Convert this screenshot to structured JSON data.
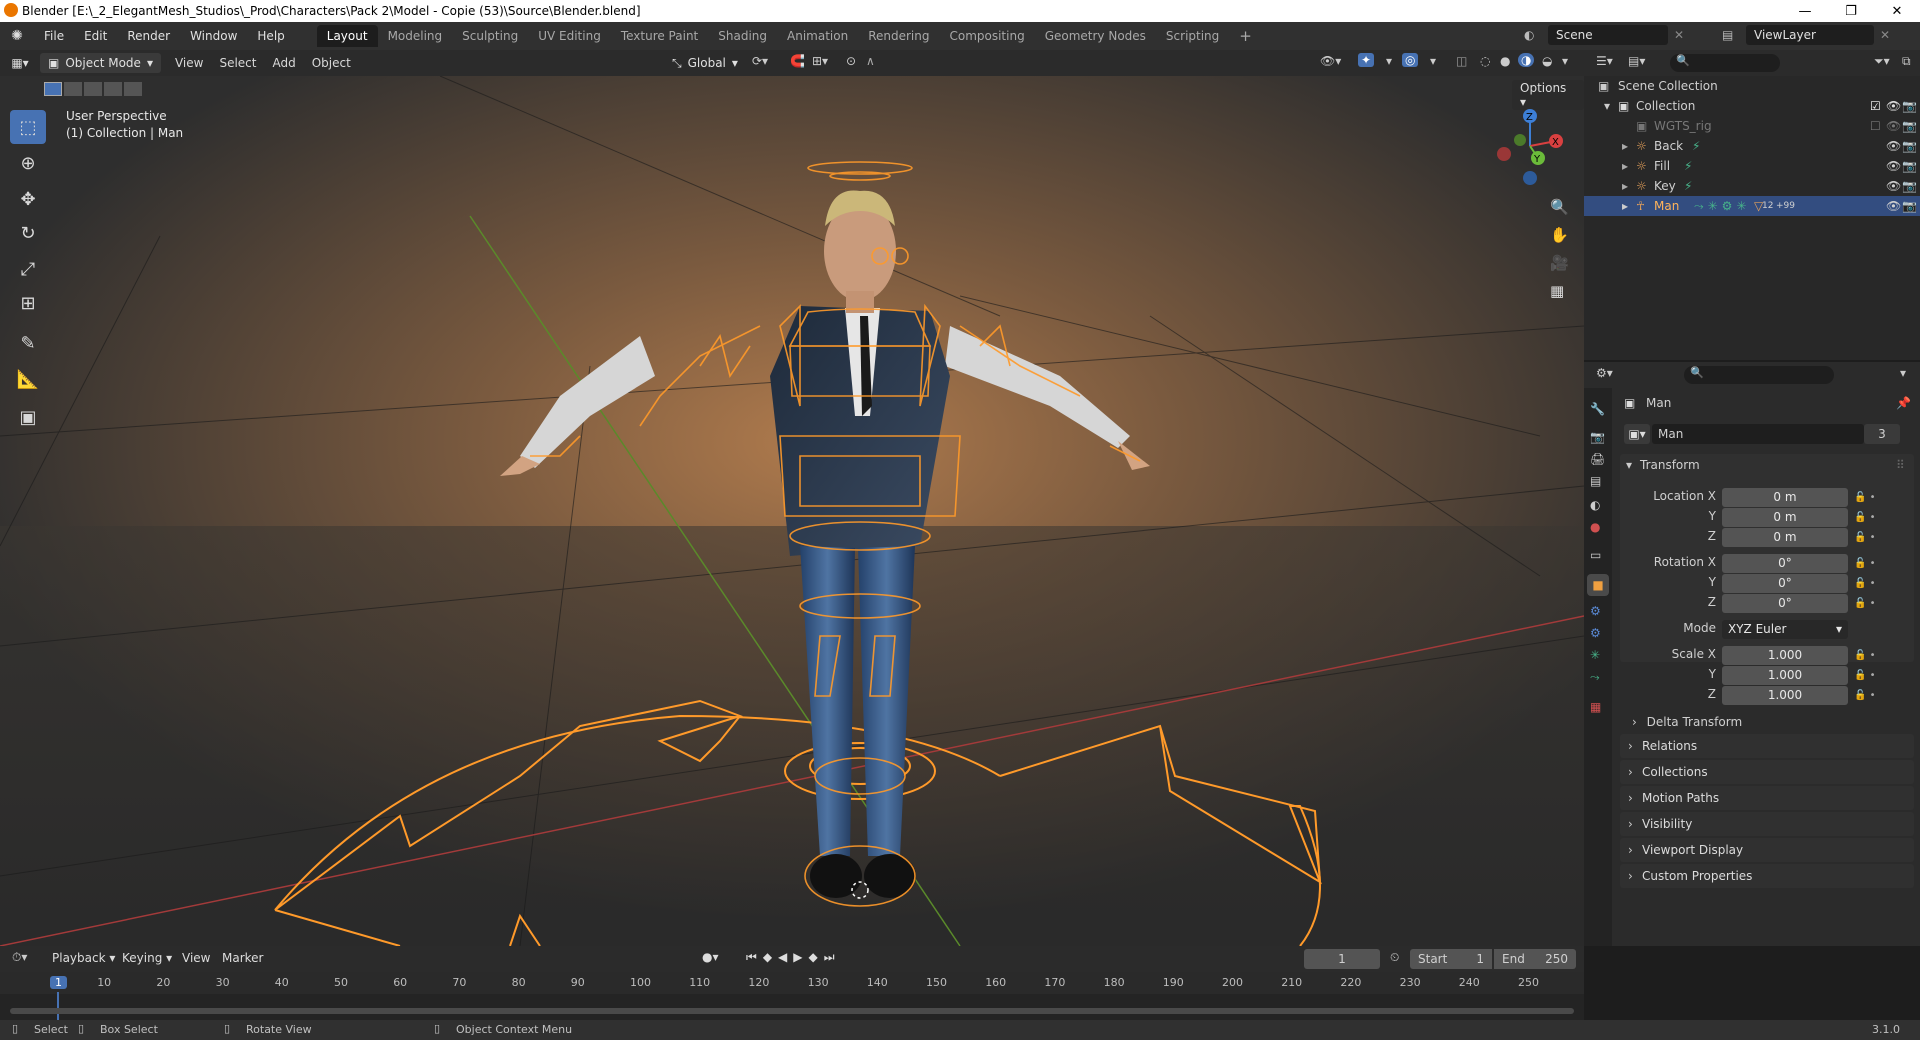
{
  "window": {
    "title": "Blender [E:\\_2_ElegantMesh_Studios\\_Prod\\Characters\\Pack 2\\Model - Copie (53)\\Source\\Blender.blend]",
    "minimize": "—",
    "maximize": "❐",
    "close": "✕"
  },
  "topbar": {
    "menus": [
      "File",
      "Edit",
      "Render",
      "Window",
      "Help"
    ],
    "workspaces": [
      "Layout",
      "Modeling",
      "Sculpting",
      "UV Editing",
      "Texture Paint",
      "Shading",
      "Animation",
      "Rendering",
      "Compositing",
      "Geometry Nodes",
      "Scripting"
    ],
    "active_workspace": "Layout",
    "add_tab": "+",
    "scene": "Scene",
    "view_layer": "ViewLayer"
  },
  "viewport_header": {
    "mode": "Object Mode",
    "menus": [
      "View",
      "Select",
      "Add",
      "Object"
    ],
    "orientation": "Global",
    "options": "Options"
  },
  "viewport": {
    "perspective": "User Perspective",
    "collection_info": "(1) Collection | Man",
    "gizmo_axes": [
      "X",
      "Y",
      "Z"
    ]
  },
  "outliner": {
    "root": "Scene Collection",
    "collection": "Collection",
    "items": [
      {
        "name": "WGTS_rig",
        "dimmed": true
      },
      {
        "name": "Back",
        "dimmed": false
      },
      {
        "name": "Fill",
        "dimmed": false
      },
      {
        "name": "Key",
        "dimmed": false
      },
      {
        "name": "Man",
        "dimmed": false,
        "selected": true,
        "badge": "12",
        "extra": "+99"
      }
    ]
  },
  "properties": {
    "object_name": "Man",
    "datablock_name": "Man",
    "user_count": "3",
    "transform_label": "Transform",
    "location_label": "Location X",
    "rotation_label": "Rotation X",
    "scale_label": "Scale X",
    "y_label": "Y",
    "z_label": "Z",
    "location": [
      "0 m",
      "0 m",
      "0 m"
    ],
    "rotation": [
      "0°",
      "0°",
      "0°"
    ],
    "mode_label": "Mode",
    "mode_value": "XYZ Euler",
    "scale": [
      "1.000",
      "1.000",
      "1.000"
    ],
    "delta_transform": "Delta Transform",
    "panels": [
      "Relations",
      "Collections",
      "Motion Paths",
      "Visibility",
      "Viewport Display",
      "Custom Properties"
    ]
  },
  "timeline": {
    "menus": [
      "Playback",
      "Keying",
      "View",
      "Marker"
    ],
    "current_frame": "1",
    "start_label": "Start",
    "start_value": "1",
    "end_label": "End",
    "end_value": "250",
    "ticks": [
      "1",
      "10",
      "20",
      "30",
      "40",
      "50",
      "60",
      "70",
      "80",
      "90",
      "100",
      "110",
      "120",
      "130",
      "140",
      "150",
      "160",
      "170",
      "180",
      "190",
      "200",
      "210",
      "220",
      "230",
      "240",
      "250"
    ]
  },
  "statusbar": {
    "select": "Select",
    "box_select": "Box Select",
    "rotate_view": "Rotate View",
    "context_menu": "Object Context Menu",
    "version": "3.1.0"
  },
  "colors": {
    "accent": "#4772b3",
    "selection_orange": "#ff9a2a",
    "x_axis": "#d94040",
    "y_axis": "#6bbb3a",
    "z_axis": "#3d7fd6"
  }
}
